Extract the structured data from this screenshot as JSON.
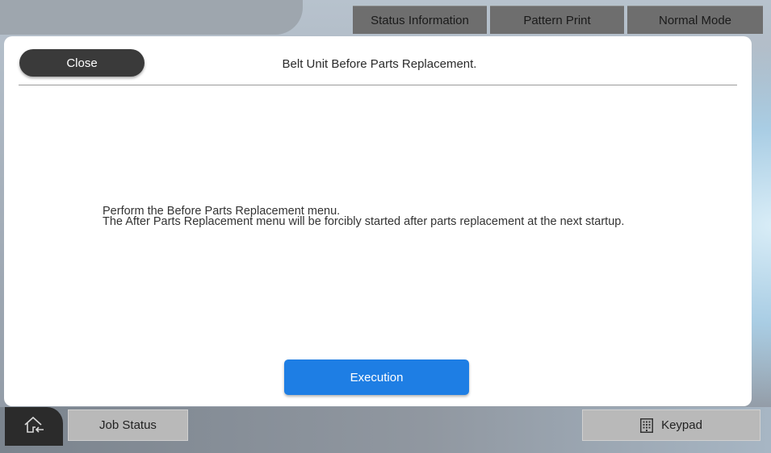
{
  "header": {
    "tabs": [
      {
        "label": "Status Information"
      },
      {
        "label": "Pattern Print"
      },
      {
        "label": "Normal Mode"
      }
    ]
  },
  "dialog": {
    "close_label": "Close",
    "title": "Belt Unit Before Parts Replacement.",
    "message_lines": [
      "Perform the Before Parts Replacement menu.",
      "The After Parts Replacement menu will be forcibly started after parts replacement at the next startup."
    ],
    "execute_label": "Execution"
  },
  "footer": {
    "home_icon": "home-back-icon",
    "job_status_label": "Job Status",
    "keypad_icon": "keypad-icon",
    "keypad_label": "Keypad"
  },
  "colors": {
    "accent": "#1e7ee4",
    "close_button": "#3a3a3a"
  }
}
